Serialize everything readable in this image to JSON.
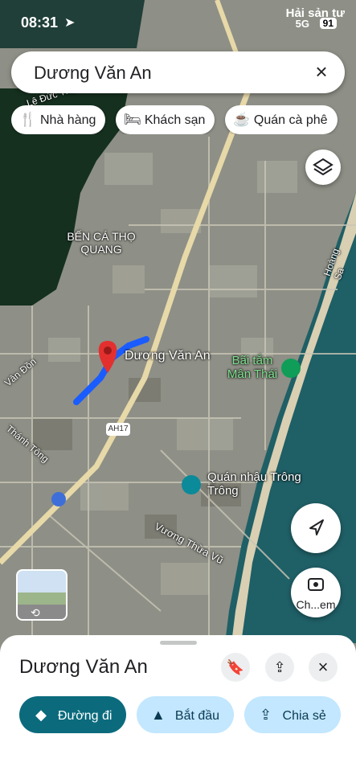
{
  "status_bar": {
    "time": "08:31",
    "carrier": "Hải sản tư",
    "network": "5G",
    "battery": "91"
  },
  "search": {
    "query": "Dương Văn An",
    "clear_icon": "close-icon"
  },
  "chips": [
    {
      "label": "Nhà hàng",
      "icon": "restaurant-icon"
    },
    {
      "label": "Khách sạn",
      "icon": "hotel-icon"
    },
    {
      "label": "Quán cà phê",
      "icon": "cafe-icon"
    }
  ],
  "map": {
    "labels": {
      "area": "BẾN CÁ THỌ QUANG",
      "selected_place": "Dương Văn An",
      "beach": "Bãi tắm Mân Thái",
      "restaurant": "Quán nhậu Trông Trông",
      "road_vuong_thua_vu": "Vương Thừa Vũ",
      "road_hoang_sa": "Hoàng Sa",
      "road_van_don": "Vân Đồn",
      "road_thanh_tong": "Thánh Tông",
      "road_le_duc_tho": "Lê Đức Thọ",
      "highway": "AH17"
    },
    "camera_label": "Ch...em",
    "colors": {
      "route": "#1a5cff",
      "pin": "#e3302f",
      "poi_green": "#0f9d58",
      "poi_teal": "#0b8a9a"
    }
  },
  "place_sheet": {
    "title": "Dương Văn An",
    "actions": [
      {
        "label": "Đường đi",
        "icon": "directions-icon"
      },
      {
        "label": "Bắt đầu",
        "icon": "navigation-arrow-icon"
      },
      {
        "label": "Chia sẻ",
        "icon": "share-icon"
      }
    ]
  }
}
